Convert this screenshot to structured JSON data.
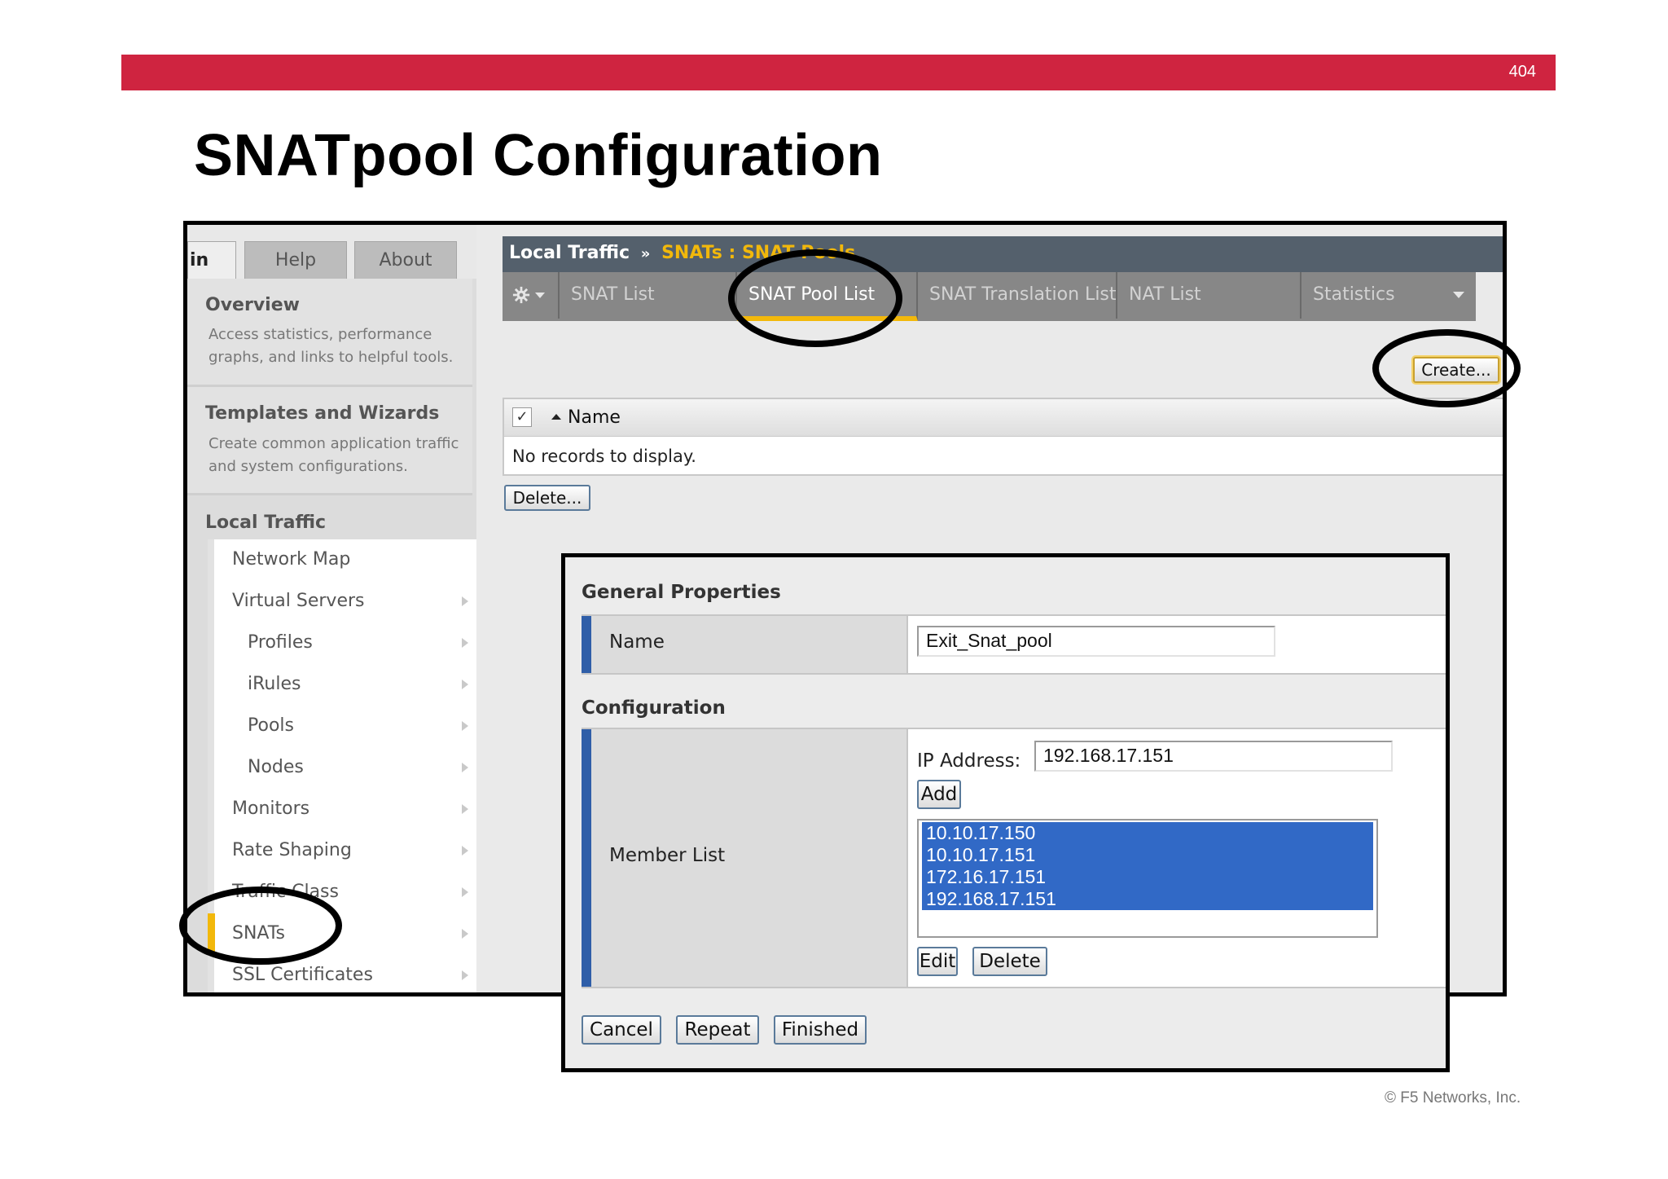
{
  "slide": {
    "number": "404",
    "title": "SNATpool Configuration",
    "copyright": "© F5 Networks, Inc."
  },
  "colors": {
    "banner": "#cf2440",
    "accent_yellow": "#f2b80b",
    "selection_blue": "#3169c6"
  },
  "left_tabs": {
    "main_partial": "in",
    "help": "Help",
    "about": "About"
  },
  "sidebar": {
    "overview": {
      "title": "Overview",
      "description": "Access statistics, performance graphs, and links to helpful tools."
    },
    "templates": {
      "title": "Templates and Wizards",
      "description": "Create common application traffic and system configurations."
    },
    "local_traffic_heading": "Local Traffic",
    "items": [
      {
        "label": "Network Map"
      },
      {
        "label": "Virtual Servers"
      },
      {
        "label": "Profiles"
      },
      {
        "label": "iRules"
      },
      {
        "label": "Pools"
      },
      {
        "label": "Nodes"
      },
      {
        "label": "Monitors"
      },
      {
        "label": "Rate Shaping"
      },
      {
        "label": "Traffic Class"
      },
      {
        "label": "SNATs"
      },
      {
        "label": "SSL Certificates"
      }
    ]
  },
  "breadcrumb": {
    "section": "Local Traffic",
    "separator": "»",
    "current": "SNATs : SNAT Pools"
  },
  "subtabs": {
    "gear_icon": "gear-icon",
    "snat_list": "SNAT List",
    "snat_pool_list": "SNAT Pool List",
    "snat_translation_list": "SNAT Translation List",
    "nat_list": "NAT List",
    "statistics": "Statistics"
  },
  "list": {
    "create_button": "Create...",
    "column_name": "Name",
    "check_mark": "✓",
    "empty_message": "No records to display.",
    "delete_button": "Delete..."
  },
  "form": {
    "general_properties_heading": "General Properties",
    "name_label": "Name",
    "name_value": "Exit_Snat_pool",
    "configuration_heading": "Configuration",
    "member_list_label": "Member List",
    "ip_address_label": "IP Address:",
    "ip_address_value": "192.168.17.151",
    "add_button": "Add",
    "members": [
      "10.10.17.150",
      "10.10.17.151",
      "172.16.17.151",
      "192.168.17.151"
    ],
    "edit_button": "Edit",
    "delete_button": "Delete",
    "cancel_button": "Cancel",
    "repeat_button": "Repeat",
    "finished_button": "Finished"
  }
}
